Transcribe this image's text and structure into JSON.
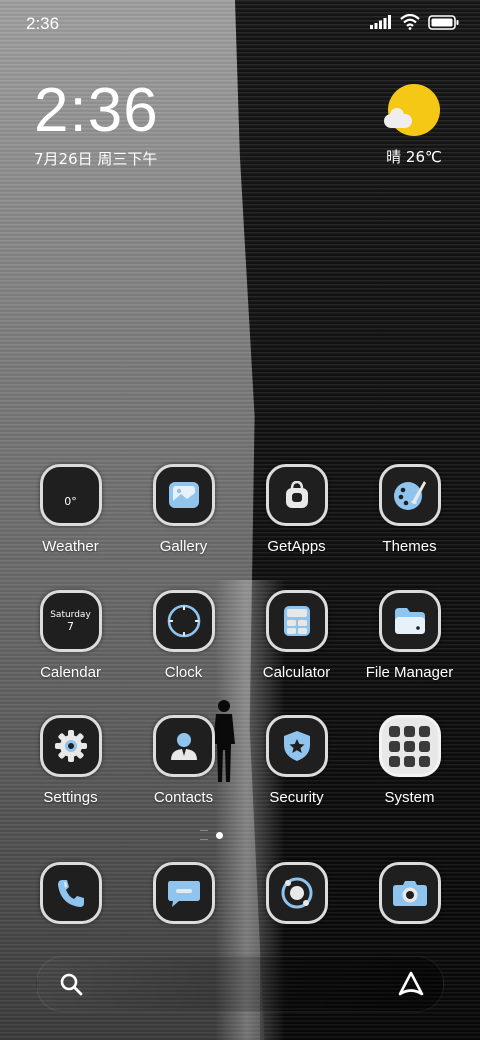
{
  "status_bar": {
    "time": "2:36"
  },
  "clock_widget": {
    "time": "2:36",
    "date": "7月26日 周三下午"
  },
  "weather_widget": {
    "condition_temp": "晴 26℃"
  },
  "apps_row1": [
    {
      "label": "Weather",
      "icon": "weather-icon",
      "icon_text": "0°"
    },
    {
      "label": "Gallery",
      "icon": "gallery-icon"
    },
    {
      "label": "GetApps",
      "icon": "getapps-icon"
    },
    {
      "label": "Themes",
      "icon": "themes-icon"
    }
  ],
  "apps_row2": [
    {
      "label": "Calendar",
      "icon": "calendar-icon",
      "icon_day": "Saturday",
      "icon_date": "7"
    },
    {
      "label": "Clock",
      "icon": "clock-icon"
    },
    {
      "label": "Calculator",
      "icon": "calculator-icon"
    },
    {
      "label": "File Manager",
      "icon": "file-manager-icon"
    }
  ],
  "apps_row3": [
    {
      "label": "Settings",
      "icon": "settings-icon"
    },
    {
      "label": "Contacts",
      "icon": "contacts-icon"
    },
    {
      "label": "Security",
      "icon": "security-icon"
    },
    {
      "label": "System",
      "icon": "system-folder-icon"
    }
  ],
  "dock": [
    {
      "icon": "phone-icon"
    },
    {
      "icon": "messages-icon"
    },
    {
      "icon": "browser-icon"
    },
    {
      "icon": "camera-icon"
    }
  ],
  "colors": {
    "accent_blue": "#8fc4ef",
    "sun_yellow": "#f6c816"
  }
}
